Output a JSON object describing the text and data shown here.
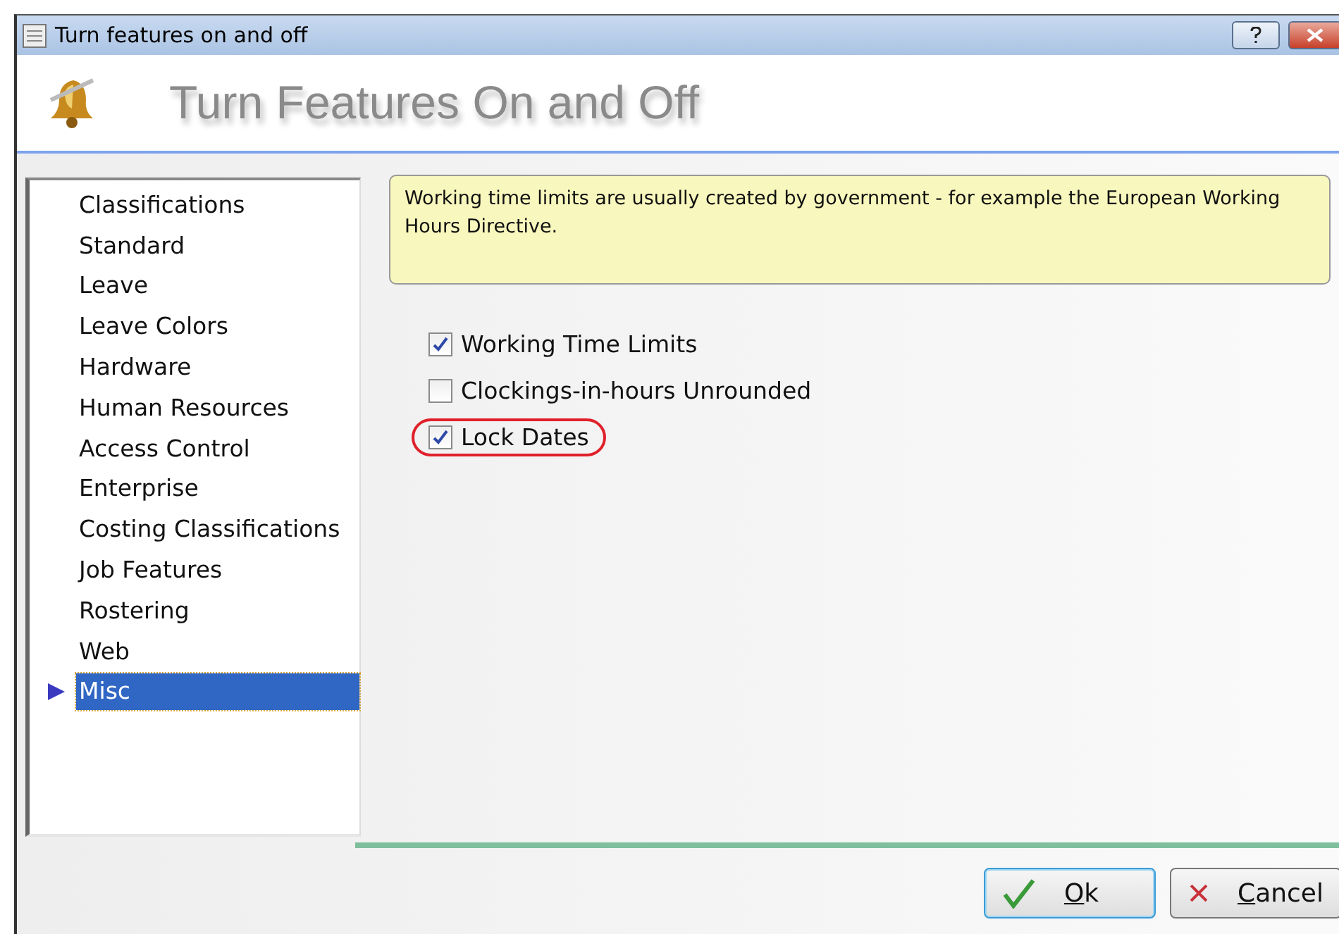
{
  "window": {
    "title": "Turn features on and off"
  },
  "header": {
    "title": "Turn Features On and Off"
  },
  "sidebar": {
    "items": [
      {
        "label": "Classifications",
        "selected": false
      },
      {
        "label": "Standard",
        "selected": false
      },
      {
        "label": "Leave",
        "selected": false
      },
      {
        "label": "Leave Colors",
        "selected": false
      },
      {
        "label": "Hardware",
        "selected": false
      },
      {
        "label": "Human Resources",
        "selected": false
      },
      {
        "label": "Access Control",
        "selected": false
      },
      {
        "label": "Enterprise",
        "selected": false
      },
      {
        "label": "Costing Classifications",
        "selected": false
      },
      {
        "label": "Job Features",
        "selected": false
      },
      {
        "label": "Rostering",
        "selected": false
      },
      {
        "label": "Web",
        "selected": false
      },
      {
        "label": "Misc",
        "selected": true
      }
    ]
  },
  "note": "Working time limits are usually created by government - for example the European Working Hours Directive.",
  "options": [
    {
      "label": "Working Time Limits",
      "checked": true,
      "highlighted": false
    },
    {
      "label": "Clockings-in-hours Unrounded",
      "checked": false,
      "highlighted": false
    },
    {
      "label": "Lock Dates",
      "checked": true,
      "highlighted": true
    }
  ],
  "buttons": [
    {
      "kind": "ok",
      "mnemonic": "O",
      "rest": "k"
    },
    {
      "kind": "cancel",
      "mnemonic": "C",
      "rest": "ancel"
    }
  ]
}
